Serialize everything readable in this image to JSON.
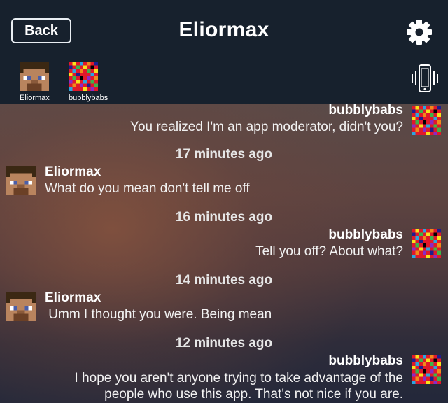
{
  "header": {
    "back_label": "Back",
    "title": "Eliormax"
  },
  "participants": [
    {
      "name": "Eliormax",
      "icon": "steve-avatar-icon"
    },
    {
      "name": "bubblybabs",
      "icon": "rainbow-avatar-icon"
    }
  ],
  "messages": [
    {
      "sender": "bubblybabs",
      "side": "right",
      "text": "You realized I'm an app moderator, didn't you?"
    },
    {
      "time": "17 minutes ago"
    },
    {
      "sender": "Eliormax",
      "side": "left",
      "text": "What do you mean don't tell me off"
    },
    {
      "time": "16 minutes ago"
    },
    {
      "sender": "bubblybabs",
      "side": "right",
      "text": "Tell you off?  About what?"
    },
    {
      "time": "14 minutes ago"
    },
    {
      "sender": "Eliormax",
      "side": "left",
      "text": " Umm I thought you were. Being mean"
    },
    {
      "time": "12 minutes ago"
    },
    {
      "sender": "bubblybabs",
      "side": "right",
      "text_lines": [
        "I hope you aren't anyone trying to take advantage of the",
        "people who use this app.  That's not nice if you are."
      ]
    }
  ],
  "colors": {
    "header_bg": "#17212d",
    "text": "#ffffff"
  }
}
